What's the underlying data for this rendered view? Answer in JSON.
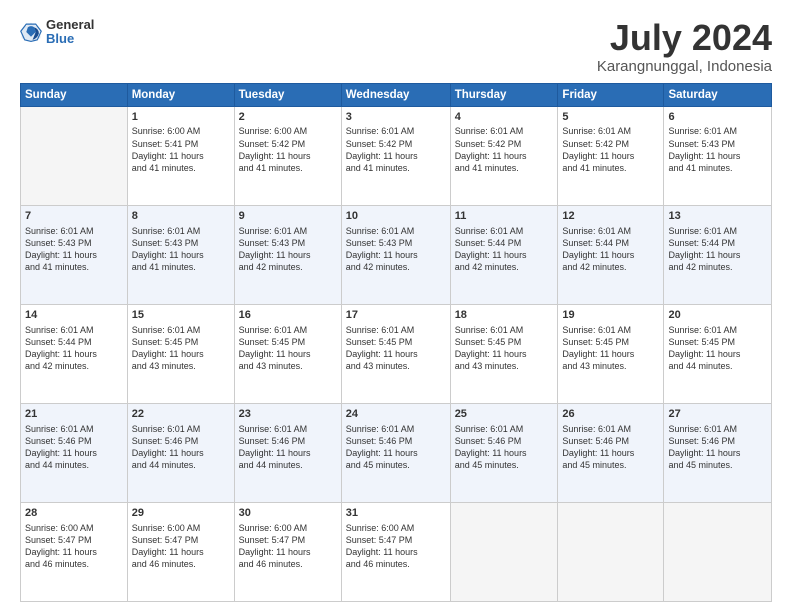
{
  "logo": {
    "general": "General",
    "blue": "Blue",
    "icon_color": "#2a6db5"
  },
  "title": "July 2024",
  "location": "Karangnunggal, Indonesia",
  "days_header": [
    "Sunday",
    "Monday",
    "Tuesday",
    "Wednesday",
    "Thursday",
    "Friday",
    "Saturday"
  ],
  "weeks": [
    [
      {
        "num": "",
        "info": ""
      },
      {
        "num": "1",
        "info": "Sunrise: 6:00 AM\nSunset: 5:41 PM\nDaylight: 11 hours\nand 41 minutes."
      },
      {
        "num": "2",
        "info": "Sunrise: 6:00 AM\nSunset: 5:42 PM\nDaylight: 11 hours\nand 41 minutes."
      },
      {
        "num": "3",
        "info": "Sunrise: 6:01 AM\nSunset: 5:42 PM\nDaylight: 11 hours\nand 41 minutes."
      },
      {
        "num": "4",
        "info": "Sunrise: 6:01 AM\nSunset: 5:42 PM\nDaylight: 11 hours\nand 41 minutes."
      },
      {
        "num": "5",
        "info": "Sunrise: 6:01 AM\nSunset: 5:42 PM\nDaylight: 11 hours\nand 41 minutes."
      },
      {
        "num": "6",
        "info": "Sunrise: 6:01 AM\nSunset: 5:43 PM\nDaylight: 11 hours\nand 41 minutes."
      }
    ],
    [
      {
        "num": "7",
        "info": "Sunrise: 6:01 AM\nSunset: 5:43 PM\nDaylight: 11 hours\nand 41 minutes."
      },
      {
        "num": "8",
        "info": "Sunrise: 6:01 AM\nSunset: 5:43 PM\nDaylight: 11 hours\nand 41 minutes."
      },
      {
        "num": "9",
        "info": "Sunrise: 6:01 AM\nSunset: 5:43 PM\nDaylight: 11 hours\nand 42 minutes."
      },
      {
        "num": "10",
        "info": "Sunrise: 6:01 AM\nSunset: 5:43 PM\nDaylight: 11 hours\nand 42 minutes."
      },
      {
        "num": "11",
        "info": "Sunrise: 6:01 AM\nSunset: 5:44 PM\nDaylight: 11 hours\nand 42 minutes."
      },
      {
        "num": "12",
        "info": "Sunrise: 6:01 AM\nSunset: 5:44 PM\nDaylight: 11 hours\nand 42 minutes."
      },
      {
        "num": "13",
        "info": "Sunrise: 6:01 AM\nSunset: 5:44 PM\nDaylight: 11 hours\nand 42 minutes."
      }
    ],
    [
      {
        "num": "14",
        "info": "Sunrise: 6:01 AM\nSunset: 5:44 PM\nDaylight: 11 hours\nand 42 minutes."
      },
      {
        "num": "15",
        "info": "Sunrise: 6:01 AM\nSunset: 5:45 PM\nDaylight: 11 hours\nand 43 minutes."
      },
      {
        "num": "16",
        "info": "Sunrise: 6:01 AM\nSunset: 5:45 PM\nDaylight: 11 hours\nand 43 minutes."
      },
      {
        "num": "17",
        "info": "Sunrise: 6:01 AM\nSunset: 5:45 PM\nDaylight: 11 hours\nand 43 minutes."
      },
      {
        "num": "18",
        "info": "Sunrise: 6:01 AM\nSunset: 5:45 PM\nDaylight: 11 hours\nand 43 minutes."
      },
      {
        "num": "19",
        "info": "Sunrise: 6:01 AM\nSunset: 5:45 PM\nDaylight: 11 hours\nand 43 minutes."
      },
      {
        "num": "20",
        "info": "Sunrise: 6:01 AM\nSunset: 5:45 PM\nDaylight: 11 hours\nand 44 minutes."
      }
    ],
    [
      {
        "num": "21",
        "info": "Sunrise: 6:01 AM\nSunset: 5:46 PM\nDaylight: 11 hours\nand 44 minutes."
      },
      {
        "num": "22",
        "info": "Sunrise: 6:01 AM\nSunset: 5:46 PM\nDaylight: 11 hours\nand 44 minutes."
      },
      {
        "num": "23",
        "info": "Sunrise: 6:01 AM\nSunset: 5:46 PM\nDaylight: 11 hours\nand 44 minutes."
      },
      {
        "num": "24",
        "info": "Sunrise: 6:01 AM\nSunset: 5:46 PM\nDaylight: 11 hours\nand 45 minutes."
      },
      {
        "num": "25",
        "info": "Sunrise: 6:01 AM\nSunset: 5:46 PM\nDaylight: 11 hours\nand 45 minutes."
      },
      {
        "num": "26",
        "info": "Sunrise: 6:01 AM\nSunset: 5:46 PM\nDaylight: 11 hours\nand 45 minutes."
      },
      {
        "num": "27",
        "info": "Sunrise: 6:01 AM\nSunset: 5:46 PM\nDaylight: 11 hours\nand 45 minutes."
      }
    ],
    [
      {
        "num": "28",
        "info": "Sunrise: 6:00 AM\nSunset: 5:47 PM\nDaylight: 11 hours\nand 46 minutes."
      },
      {
        "num": "29",
        "info": "Sunrise: 6:00 AM\nSunset: 5:47 PM\nDaylight: 11 hours\nand 46 minutes."
      },
      {
        "num": "30",
        "info": "Sunrise: 6:00 AM\nSunset: 5:47 PM\nDaylight: 11 hours\nand 46 minutes."
      },
      {
        "num": "31",
        "info": "Sunrise: 6:00 AM\nSunset: 5:47 PM\nDaylight: 11 hours\nand 46 minutes."
      },
      {
        "num": "",
        "info": ""
      },
      {
        "num": "",
        "info": ""
      },
      {
        "num": "",
        "info": ""
      }
    ]
  ]
}
